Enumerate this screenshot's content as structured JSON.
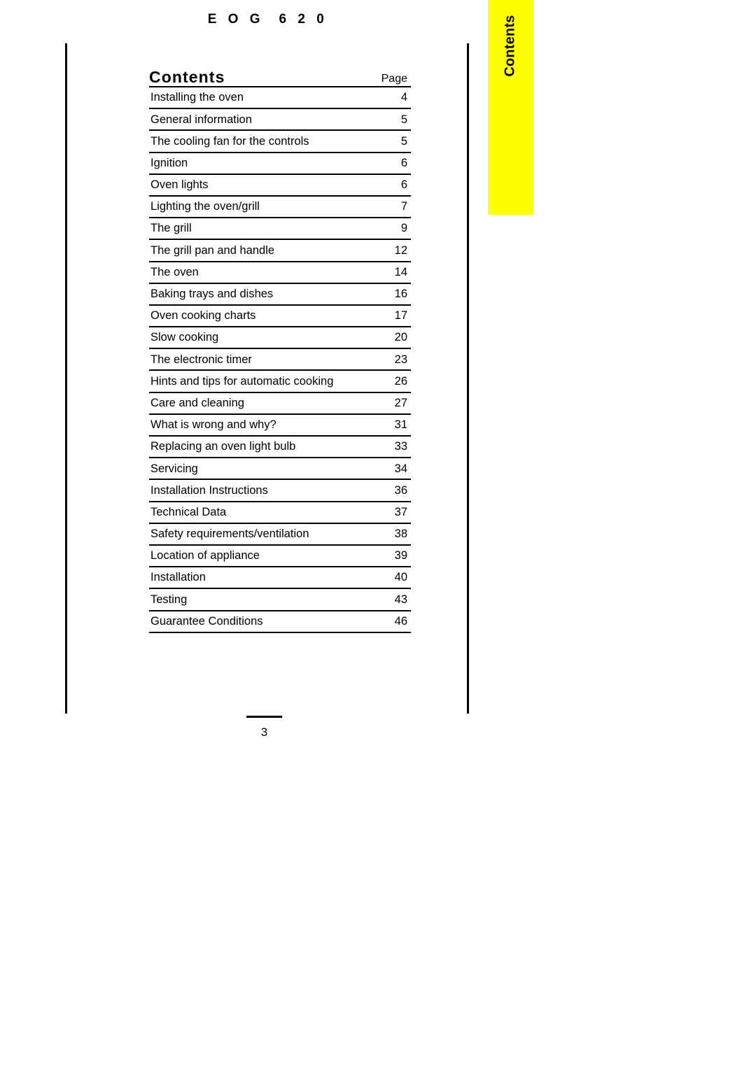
{
  "document": {
    "model_header": "E O G  6 2 0",
    "page_number": "3"
  },
  "thumb_tab": {
    "label": "Contents",
    "color": "#FFFF00"
  },
  "contents": {
    "title": "Contents",
    "page_column_header": "Page",
    "rows": [
      {
        "title": "Installing the oven",
        "page": "4"
      },
      {
        "title": "General information",
        "page": "5"
      },
      {
        "title": "The cooling fan for the controls",
        "page": "5"
      },
      {
        "title": "Ignition",
        "page": "6"
      },
      {
        "title": "Oven lights",
        "page": "6"
      },
      {
        "title": "Lighting the oven/grill",
        "page": "7"
      },
      {
        "title": "The grill",
        "page": "9"
      },
      {
        "title": "The grill pan and handle",
        "page": "12"
      },
      {
        "title": "The oven",
        "page": "14"
      },
      {
        "title": "Baking trays and dishes",
        "page": "16"
      },
      {
        "title": "Oven cooking charts",
        "page": "17"
      },
      {
        "title": "Slow cooking",
        "page": "20"
      },
      {
        "title": "The electronic timer",
        "page": "23"
      },
      {
        "title": "Hints and tips for automatic cooking",
        "page": "26"
      },
      {
        "title": "Care and cleaning",
        "page": "27"
      },
      {
        "title": "What is wrong and why?",
        "page": "31"
      },
      {
        "title": "Replacing an oven light bulb",
        "page": "33"
      },
      {
        "title": "Servicing",
        "page": "34"
      },
      {
        "title": "Installation Instructions",
        "page": "36"
      },
      {
        "title": "Technical Data",
        "page": "37"
      },
      {
        "title": "Safety requirements/ventilation",
        "page": "38"
      },
      {
        "title": "Location of appliance",
        "page": "39"
      },
      {
        "title": "Installation",
        "page": "40"
      },
      {
        "title": "Testing",
        "page": "43"
      },
      {
        "title": "Guarantee Conditions",
        "page": "46"
      }
    ]
  }
}
